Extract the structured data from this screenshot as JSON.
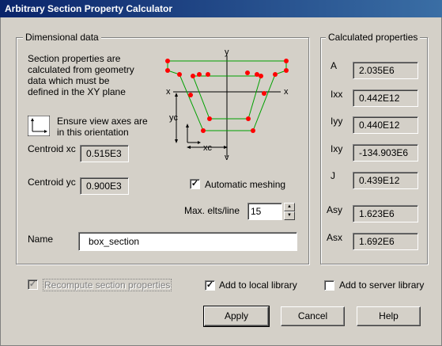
{
  "window": {
    "title": "Arbitrary Section Property Calculator"
  },
  "dimensional": {
    "title": "Dimensional data",
    "description": [
      "Section properties are",
      "calculated from geometry",
      "data which must be",
      "defined in the XY plane"
    ],
    "orientation_note": [
      "Ensure view axes are",
      "in this orientation"
    ],
    "centroid_xc_label": "Centroid xc",
    "centroid_xc_value": "0.515E3",
    "centroid_yc_label": "Centroid yc",
    "centroid_yc_value": "0.900E3",
    "diagram": {
      "axis_x": "x",
      "axis_y": "y",
      "label_xc": "xc",
      "label_yc": "yc"
    },
    "auto_meshing_label": "Automatic meshing",
    "auto_meshing_checked": true,
    "max_elts_label": "Max. elts/line",
    "max_elts_value": "15",
    "name_label": "Name",
    "name_value": "box_section"
  },
  "calculated": {
    "title": "Calculated properties",
    "props": [
      {
        "label": "A",
        "value": "2.035E6"
      },
      {
        "label": "Ixx",
        "value": "0.442E12"
      },
      {
        "label": "Iyy",
        "value": "0.440E12"
      },
      {
        "label": "Ixy",
        "value": "-134.903E6"
      },
      {
        "label": "J",
        "value": "0.439E12"
      },
      {
        "label": "Asy",
        "value": "1.623E6"
      },
      {
        "label": "Asx",
        "value": "1.692E6"
      }
    ]
  },
  "options": {
    "recompute_label": "Recompute section properties",
    "recompute_checked": true,
    "local_library_label": "Add to local library",
    "local_library_checked": true,
    "server_library_label": "Add to server library",
    "server_library_checked": false
  },
  "buttons": {
    "apply": "Apply",
    "cancel": "Cancel",
    "help": "Help"
  },
  "colors": {
    "outer_profile": "#00a000",
    "node": "#ff0000",
    "title_bar": "#0a246a"
  }
}
